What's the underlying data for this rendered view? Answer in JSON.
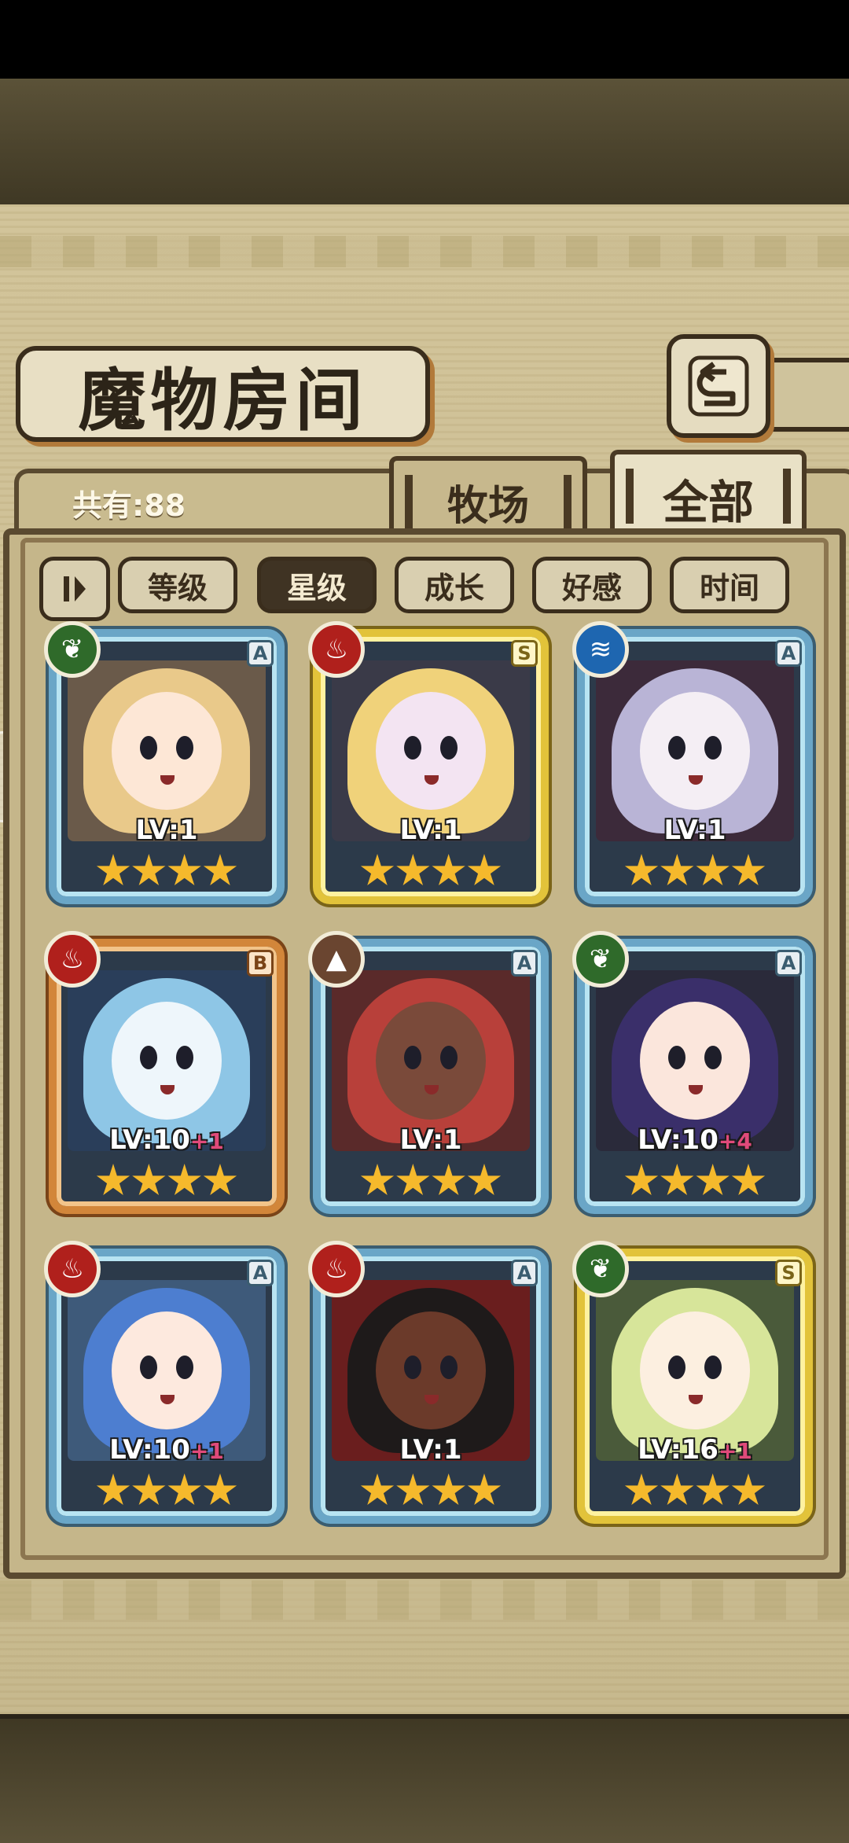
{
  "header": {
    "title": "魔物房间",
    "back_icon": "return-arrow-icon"
  },
  "count_label": "共有:88",
  "tabs": [
    {
      "label": "牧场",
      "active": false
    },
    {
      "label": "全部",
      "active": true
    }
  ],
  "sort_bar": {
    "toggle_icon": "order-toggle-icon",
    "buttons": [
      {
        "label": "等级",
        "active": false
      },
      {
        "label": "星级",
        "active": true
      },
      {
        "label": "成长",
        "active": false
      },
      {
        "label": "好感",
        "active": false
      },
      {
        "label": "时间",
        "active": false
      }
    ]
  },
  "monsters": [
    {
      "element": "grass",
      "rank": "A",
      "level": "LV:1",
      "plus": "",
      "stars": 4
    },
    {
      "element": "fire",
      "rank": "S",
      "level": "LV:1",
      "plus": "",
      "stars": 4
    },
    {
      "element": "water",
      "rank": "A",
      "level": "LV:1",
      "plus": "",
      "stars": 4
    },
    {
      "element": "fire",
      "rank": "B",
      "level": "LV:10",
      "plus": "+1",
      "stars": 4
    },
    {
      "element": "earth",
      "rank": "A",
      "level": "LV:1",
      "plus": "",
      "stars": 4
    },
    {
      "element": "grass",
      "rank": "A",
      "level": "LV:10",
      "plus": "+4",
      "stars": 4
    },
    {
      "element": "fire",
      "rank": "A",
      "level": "LV:10",
      "plus": "+1",
      "stars": 4
    },
    {
      "element": "fire",
      "rank": "A",
      "level": "LV:1",
      "plus": "",
      "stars": 4
    },
    {
      "element": "grass",
      "rank": "S",
      "level": "LV:16",
      "plus": "+1",
      "stars": 4
    }
  ],
  "colors": {
    "grass": "#2f6a2a",
    "fire": "#b0201c",
    "water": "#1e66b0",
    "earth": "#6a4530",
    "frame_A": "#6aa6c7",
    "frame_S": "#e2c33a",
    "frame_B": "#d2863a",
    "star": "#f5b92c"
  }
}
